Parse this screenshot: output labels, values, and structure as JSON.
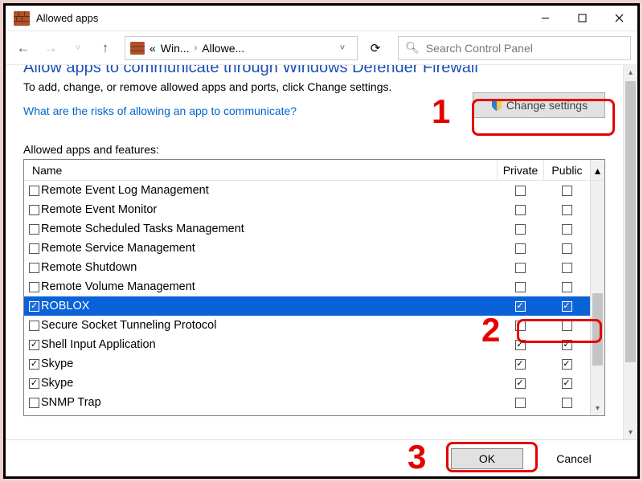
{
  "window": {
    "title": "Allowed apps"
  },
  "breadcrumb": {
    "seg1": "Win...",
    "seg2": "Allowe..."
  },
  "search": {
    "placeholder": "Search Control Panel"
  },
  "page": {
    "heading": "Allow apps to communicate through Windows Defender Firewall",
    "helptext": "To add, change, or remove allowed apps and ports, click Change settings.",
    "risk_link": "What are the risks of allowing an app to communicate?",
    "change_btn": "Change settings",
    "list_label": "Allowed apps and features:",
    "col_name": "Name",
    "col_private": "Private",
    "col_public": "Public"
  },
  "rows": [
    {
      "name": "Remote Event Log Management",
      "enabled": false,
      "priv": false,
      "pub": false,
      "sel": false
    },
    {
      "name": "Remote Event Monitor",
      "enabled": false,
      "priv": false,
      "pub": false,
      "sel": false
    },
    {
      "name": "Remote Scheduled Tasks Management",
      "enabled": false,
      "priv": false,
      "pub": false,
      "sel": false
    },
    {
      "name": "Remote Service Management",
      "enabled": false,
      "priv": false,
      "pub": false,
      "sel": false
    },
    {
      "name": "Remote Shutdown",
      "enabled": false,
      "priv": false,
      "pub": false,
      "sel": false
    },
    {
      "name": "Remote Volume Management",
      "enabled": false,
      "priv": false,
      "pub": false,
      "sel": false
    },
    {
      "name": "ROBLOX",
      "enabled": true,
      "priv": true,
      "pub": true,
      "sel": true
    },
    {
      "name": "Secure Socket Tunneling Protocol",
      "enabled": false,
      "priv": false,
      "pub": false,
      "sel": false
    },
    {
      "name": "Shell Input Application",
      "enabled": true,
      "priv": true,
      "pub": true,
      "sel": false
    },
    {
      "name": "Skype",
      "enabled": true,
      "priv": true,
      "pub": true,
      "sel": false
    },
    {
      "name": "Skype",
      "enabled": true,
      "priv": true,
      "pub": true,
      "sel": false
    },
    {
      "name": "SNMP Trap",
      "enabled": false,
      "priv": false,
      "pub": false,
      "sel": false
    }
  ],
  "footer": {
    "ok": "OK",
    "cancel": "Cancel"
  },
  "annotations": {
    "n1": "1",
    "n2": "2",
    "n3": "3"
  }
}
